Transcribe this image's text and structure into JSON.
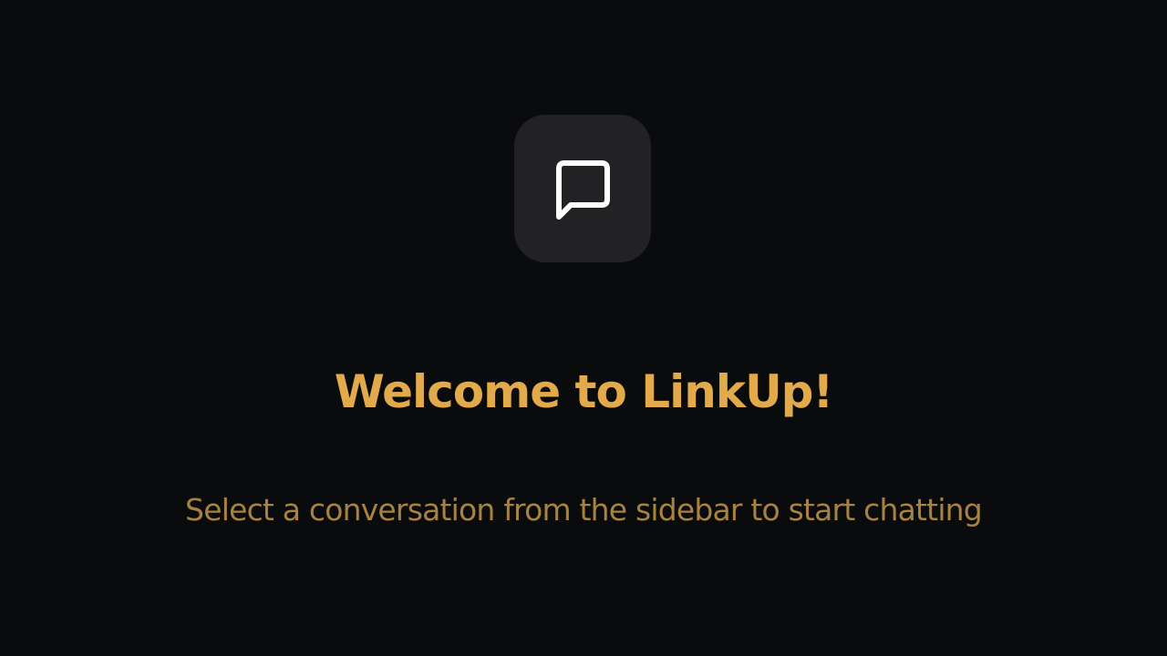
{
  "welcome": {
    "icon": "message-square-icon",
    "title": "Welcome to LinkUp!",
    "subtitle": "Select a conversation from the sidebar to start chatting"
  },
  "colors": {
    "background": "#0a0b0d",
    "icon_tile": "#222224",
    "icon_stroke": "#ffffff",
    "title": "#e3aa4b",
    "subtitle": "#a8833f"
  }
}
